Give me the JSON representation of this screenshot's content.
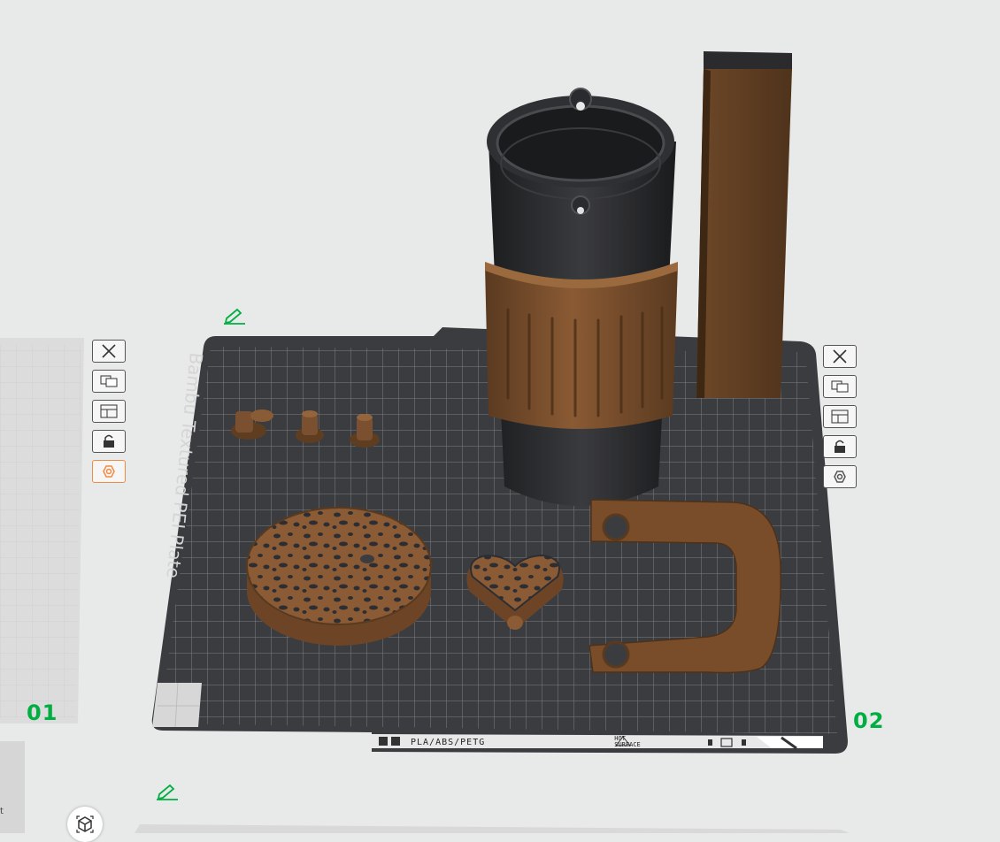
{
  "plates": [
    {
      "number": "01"
    },
    {
      "number": "02"
    }
  ],
  "bed": {
    "label": "Bambu Textured PEI Plate",
    "materials": "PLA/ABS/PETG",
    "hot_line1": "HOT",
    "hot_line2": "SURFACE"
  },
  "side_panel": {
    "text": "t"
  },
  "toolbar_icons": [
    "close-icon",
    "arrange-icon",
    "layout-icon",
    "lock-icon",
    "settings-icon"
  ],
  "colors": {
    "accent": "#00ae42",
    "active_tool": "#f28a42",
    "bed": "#3a3c3f",
    "filament_brown": "#6d4526",
    "filament_black": "#2a2b2d"
  }
}
